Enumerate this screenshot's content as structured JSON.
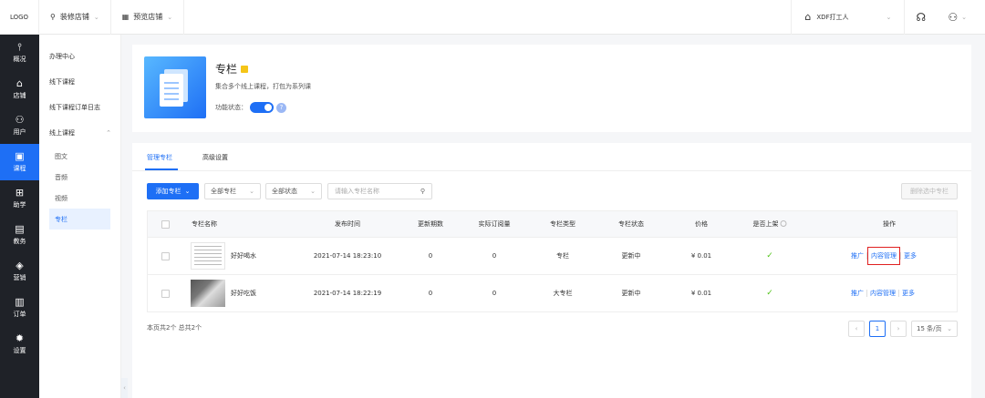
{
  "topbar": {
    "logo": "LOGO",
    "decorate_store": "装修店铺",
    "preview_store": "预览店铺",
    "store_name": "XDF打工人"
  },
  "sidebar": {
    "items": [
      {
        "label": "概况",
        "icon": "chart-icon"
      },
      {
        "label": "店铺",
        "icon": "store-icon"
      },
      {
        "label": "用户",
        "icon": "users-icon"
      },
      {
        "label": "课程",
        "icon": "course-icon",
        "active": true
      },
      {
        "label": "助学",
        "icon": "gamepad-icon"
      },
      {
        "label": "教务",
        "icon": "book-icon"
      },
      {
        "label": "营销",
        "icon": "tag-icon"
      },
      {
        "label": "订单",
        "icon": "order-icon"
      },
      {
        "label": "设置",
        "icon": "gear-icon"
      }
    ]
  },
  "subnav": {
    "office_center": "办理中心",
    "offline_course": "线下课程",
    "offline_order_log": "线下课程订单日志",
    "online_course": "线上课程",
    "children": [
      "图文",
      "音频",
      "视频",
      "专栏"
    ],
    "active_child": "专栏"
  },
  "product": {
    "title": "专栏",
    "description": "集合多个线上课程，打包为系列课",
    "status_label": "功能状态：",
    "enabled": true,
    "accent_color": "#1e6ff5"
  },
  "tabs": [
    "管理专栏",
    "高级设置"
  ],
  "toolbar": {
    "add_button": "添加专栏",
    "filter_all_columns": "全部专栏",
    "filter_all_status": "全部状态",
    "search_placeholder": "请输入专栏名称",
    "delete_selected": "删除选中专栏"
  },
  "table": {
    "headers": [
      "专栏名称",
      "发布时间",
      "更新期数",
      "实际订阅量",
      "专栏类型",
      "专栏状态",
      "价格",
      "是否上架",
      "操作"
    ],
    "rows": [
      {
        "name": "好好喝水",
        "publish_time": "2021-07-14 18:23:10",
        "episodes": "0",
        "subscriptions": "0",
        "type": "专栏",
        "status": "更新中",
        "price": "¥ 0.01",
        "listed": true,
        "ops": [
          "推广",
          "内容管理",
          "更多"
        ],
        "highlighted_op": "内容管理"
      },
      {
        "name": "好好吃饭",
        "publish_time": "2021-07-14 18:22:19",
        "episodes": "0",
        "subscriptions": "0",
        "type": "大专栏",
        "status": "更新中",
        "price": "¥ 0.01",
        "listed": true,
        "ops": [
          "推广",
          "内容管理",
          "更多"
        ]
      }
    ]
  },
  "pagination": {
    "summary": "本页共2个 总共2个",
    "current_page": "1",
    "page_size": "15 条/页"
  }
}
